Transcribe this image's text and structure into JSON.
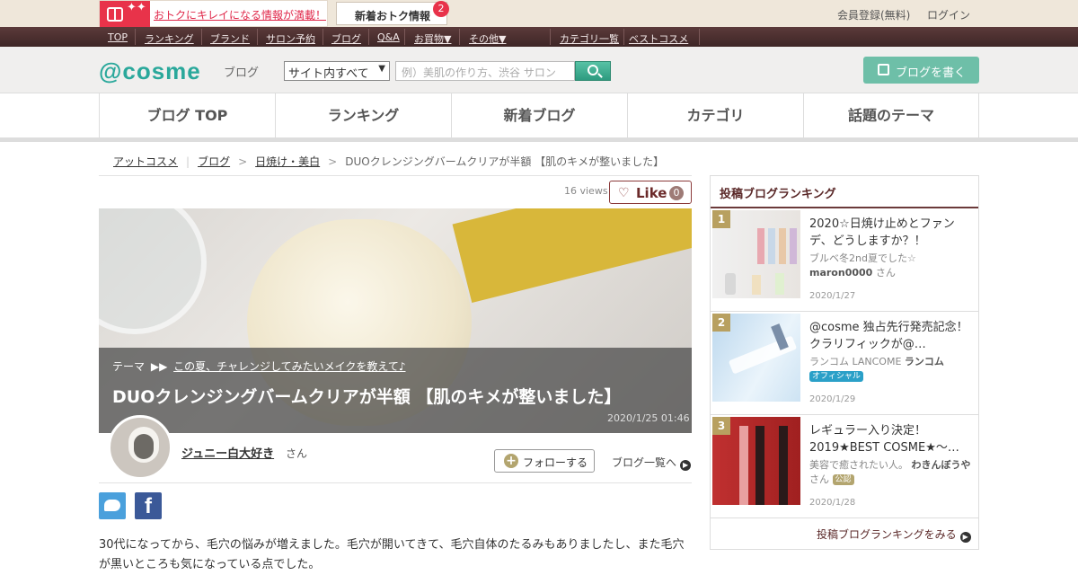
{
  "topbar": {
    "promo_text": "おトクにキレイになる情報が満載！",
    "new_info_label": "新着おトク情報",
    "new_info_count": "2",
    "member_register": "会員登録(無料)",
    "login": "ログイン"
  },
  "nav2": {
    "items": [
      "TOP",
      "ランキング",
      "ブランド",
      "サロン予約",
      "ブログ",
      "Q&A",
      "お買物▼",
      "その他▼"
    ],
    "right_items": [
      "カテゴリ一覧",
      "ベストコスメ"
    ]
  },
  "header": {
    "logo": "@cosme",
    "logo_sub": "ブログ",
    "select_value": "サイト内すべて",
    "search_placeholder": "例）美肌の作り方、渋谷 サロン",
    "write_button": "ブログを書く"
  },
  "gnav": [
    "ブログ TOP",
    "ランキング",
    "新着ブログ",
    "カテゴリ",
    "話題のテーマ"
  ],
  "breadcrumb": {
    "items": [
      "アットコスメ",
      "ブログ",
      "日焼け・美白"
    ],
    "current": "DUOクレンジングバームクリアが半額 【肌のキメが整いました】",
    "sep": ">"
  },
  "post": {
    "views": "16 views",
    "like_label": "Like",
    "like_count": "0",
    "theme_label": "テーマ",
    "theme_link": "この夏、チャレンジしてみたいメイクを教えて♪",
    "title": "DUOクレンジングバームクリアが半額 【肌のキメが整いました】",
    "date": "2020/1/25 01:46",
    "author": "ジュニー白大好き",
    "author_suffix": "さん",
    "follow_button": "フォローする",
    "blog_list_link": "ブログ一覧へ",
    "body": "30代になってから、毛穴の悩みが増えました。毛穴が開いてきて、毛穴自体のたるみもありましたし、また毛穴が黒いところも気になっている点でした。"
  },
  "sidebar": {
    "heading": "投稿ブログランキング",
    "items": [
      {
        "rank": "1",
        "title": "2020☆日焼け止めとファンデ、どうしますか？！",
        "author_pre": "ブルベ冬2nd夏でした☆",
        "author": "maron0000",
        "author_suffix": "さん",
        "badge": "",
        "date": "2020/1/27"
      },
      {
        "rank": "2",
        "title": "@cosme 独占先行発売記念！クラリフィックが@…",
        "author_pre": "ランコム LANCOME",
        "author": "ランコム",
        "author_suffix": "",
        "badge": "オフィシャル",
        "date": "2020/1/29"
      },
      {
        "rank": "3",
        "title": "レギュラー入り決定！2019★BEST COSME★～…",
        "author_pre": "美容で癒されたい人。",
        "author": "わきんぼうや",
        "author_suffix": "さん",
        "badge": "公認",
        "date": "2020/1/28"
      }
    ],
    "more_link": "投稿ブログランキングをみる",
    "colors": {
      "official": "#2aa0c8",
      "certified": "#b3a56f"
    }
  }
}
